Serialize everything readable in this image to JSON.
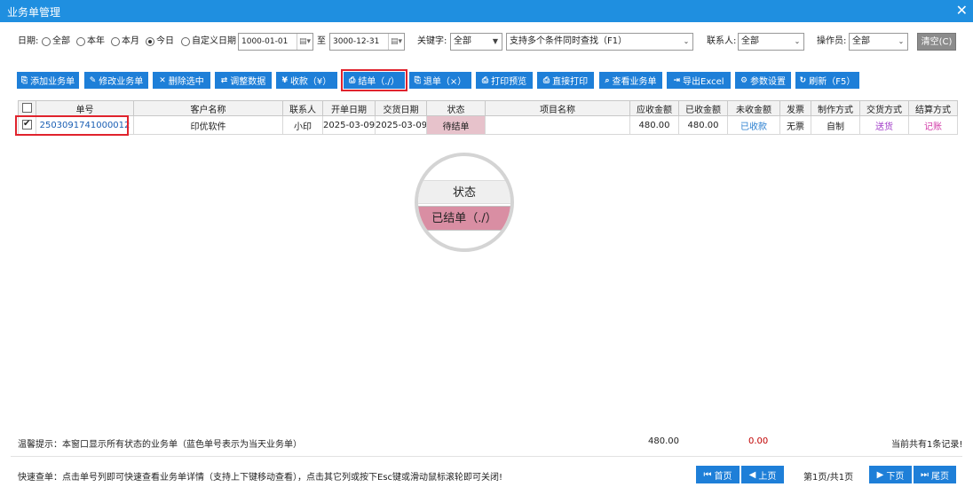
{
  "window": {
    "title": "业务单管理",
    "close": "✕"
  },
  "filter": {
    "date_label": "日期:",
    "radios": [
      "全部",
      "本年",
      "本月",
      "今日",
      "自定义日期"
    ],
    "selected_radio": 3,
    "date_from": "1000-01-01",
    "date_sep": "至",
    "date_to": "3000-12-31",
    "keyword_label": "关键字:",
    "keyword_field": "全部",
    "search_placeholder": "支持多个条件同时查找（F1）",
    "contact_label": "联系人:",
    "contact_value": "全部",
    "operator_label": "操作员:",
    "operator_value": "全部",
    "clear_label": "清空(C)"
  },
  "toolbar": {
    "add": "添加业务单",
    "edit": "修改业务单",
    "delete": "删除选中",
    "adjust": "调整数据",
    "receive": "收款（¥）",
    "settle": "结单（./）",
    "refund": "退单（×）",
    "preview": "打印预览",
    "print": "直接打印",
    "view": "查看业务单",
    "export": "导出Excel",
    "settings": "参数设置",
    "refresh": "刷新（F5）",
    "receive_icon": "¥"
  },
  "table": {
    "headers": [
      "单号",
      "客户名称",
      "联系人",
      "开单日期",
      "交货日期",
      "状态",
      "项目名称",
      "应收金额",
      "已收金额",
      "未收金额",
      "发票",
      "制作方式",
      "交货方式",
      "结算方式"
    ],
    "rows": [
      {
        "checked": true,
        "order_no": "2503091741000012",
        "customer": "印优软件",
        "contact": "小印",
        "open_date": "2025-03-09",
        "delivery_date": "2025-03-09",
        "status": "待结单",
        "project": "",
        "receivable": "480.00",
        "received": "480.00",
        "unreceived": "已收款",
        "invoice": "无票",
        "production": "自制",
        "delivery_method": "送货",
        "settlement": "记账"
      }
    ]
  },
  "zoom": {
    "header": "状态",
    "status": "已结单（./）"
  },
  "footer": {
    "tip": "温馨提示：本窗口显示所有状态的业务单（蓝色单号表示为当天业务单）",
    "total_receivable": "480.00",
    "total_unreceived": "0.00",
    "record_count": "当前共有1条记录!",
    "quick_tip": "快速查单：点击单号列即可快速查看业务单详情（支持上下键移动查看），点击其它列或按下Esc键或滑动鼠标滚轮即可关闭!",
    "first": "首页",
    "prev": "上页",
    "page_info": "第1页/共1页",
    "next": "下页",
    "last": "尾页"
  },
  "colors": {
    "titlebar": "#1f8fe0",
    "button": "#1e7fd8",
    "highlight": "#e0232d",
    "status_bg": "#e7c2cb",
    "unreceived_red": "#c00000"
  }
}
